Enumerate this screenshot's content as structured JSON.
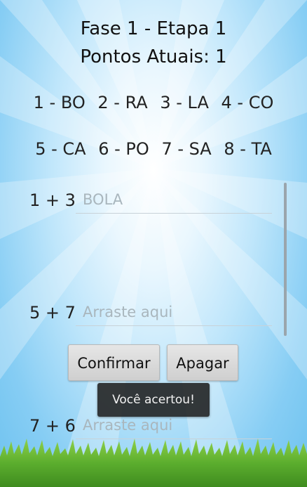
{
  "header": {
    "title": "Fase 1 - Etapa 1",
    "score": "Pontos Atuais: 1"
  },
  "syllables": {
    "row1": [
      "1 - BO",
      "2 - RA",
      "3 - LA",
      "4 - CO"
    ],
    "row2": [
      "5 - CA",
      "6 - PO",
      "7 - SA",
      "8 - TA"
    ]
  },
  "puzzles": [
    {
      "equation": "1 + 3",
      "value": "BOLA",
      "placeholder": "Arraste aqui"
    },
    {
      "equation": "5 + 7",
      "value": "",
      "placeholder": "Arraste aqui"
    },
    {
      "equation": "7 + 6",
      "value": "",
      "placeholder": "Arraste aqui"
    }
  ],
  "buttons": {
    "confirm": "Confirmar",
    "clear": "Apagar"
  },
  "toast": "Você acertou!",
  "colors": {
    "sky": "#86cdf4",
    "grass": "#5cae2e",
    "toast_bg": "#1e1e1e"
  }
}
